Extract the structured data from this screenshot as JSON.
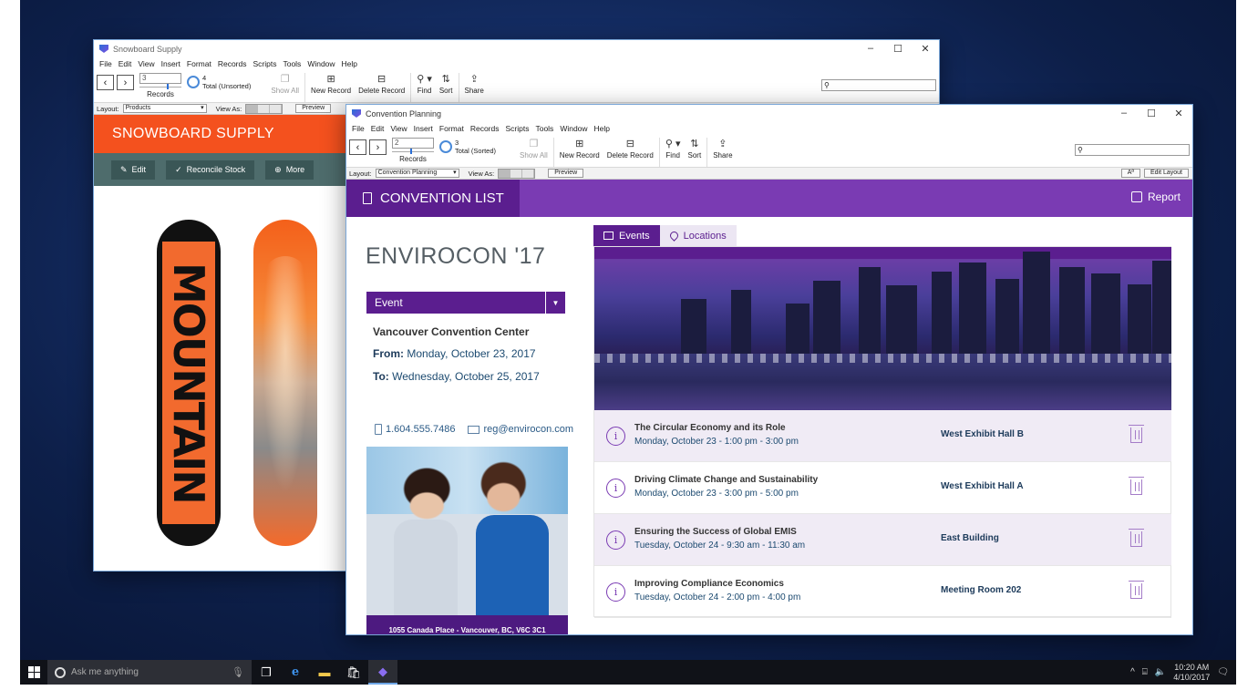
{
  "taskbar": {
    "search_placeholder": "Ask me anything",
    "time": "10:20 AM",
    "date": "4/10/2017"
  },
  "snow_window": {
    "title": "Snowboard Supply",
    "menu": [
      "File",
      "Edit",
      "View",
      "Insert",
      "Format",
      "Records",
      "Scripts",
      "Tools",
      "Window",
      "Help"
    ],
    "record_field": "3",
    "records_label": "Records",
    "total_count": "4",
    "total_label": "Total (Unsorted)",
    "show_all": "Show All",
    "new_record": "New Record",
    "delete_record": "Delete Record",
    "find": "Find",
    "sort": "Sort",
    "share": "Share",
    "layout_label": "Layout:",
    "layout_value": "Products",
    "view_as": "View As:",
    "preview": "Preview",
    "header_title": "SNOWBOARD SUPPLY",
    "actions": [
      "Edit",
      "Reconcile Stock",
      "More"
    ],
    "board_text": "MOUNTAIN"
  },
  "conv_window": {
    "title": "Convention Planning",
    "menu": [
      "File",
      "Edit",
      "View",
      "Insert",
      "Format",
      "Records",
      "Scripts",
      "Tools",
      "Window",
      "Help"
    ],
    "record_field": "2",
    "records_label": "Records",
    "total_count": "3",
    "total_label": "Total (Sorted)",
    "show_all": "Show All",
    "new_record": "New Record",
    "delete_record": "Delete Record",
    "find": "Find",
    "sort": "Sort",
    "share": "Share",
    "layout_label": "Layout:",
    "layout_value": "Convention Planning",
    "view_as": "View As:",
    "preview": "Preview",
    "aa": "Aª",
    "edit_layout": "Edit Layout",
    "header_title": "CONVENTION LIST",
    "report": "Report",
    "event_name": "ENVIROCON '17",
    "event_dropdown": "Event",
    "venue": "Vancouver Convention Center",
    "from_label": "From:",
    "from_date": "Monday, October 23, 2017",
    "to_label": "To:",
    "to_date": "Wednesday, October 25, 2017",
    "phone": "1.604.555.7486",
    "email": "reg@envirocon.com",
    "address": "1055 Canada Place - Vancouver, BC, V6C 3C1",
    "tabs": [
      "Events",
      "Locations"
    ],
    "events": [
      {
        "title": "The Circular Economy and its Role",
        "time": "Monday, October 23 - 1:00 pm - 3:00 pm",
        "location": "West Exhibit Hall B"
      },
      {
        "title": "Driving Climate Change and Sustainability",
        "time": "Monday, October 23 - 3:00 pm - 5:00 pm",
        "location": "West Exhibit Hall A"
      },
      {
        "title": "Ensuring the Success of Global EMIS",
        "time": "Tuesday, October 24 - 9:30 am - 11:30 am",
        "location": "East Building"
      },
      {
        "title": "Improving Compliance Economics",
        "time": "Tuesday, October 24 - 2:00 pm - 4:00 pm",
        "location": "Meeting Room 202"
      }
    ]
  }
}
